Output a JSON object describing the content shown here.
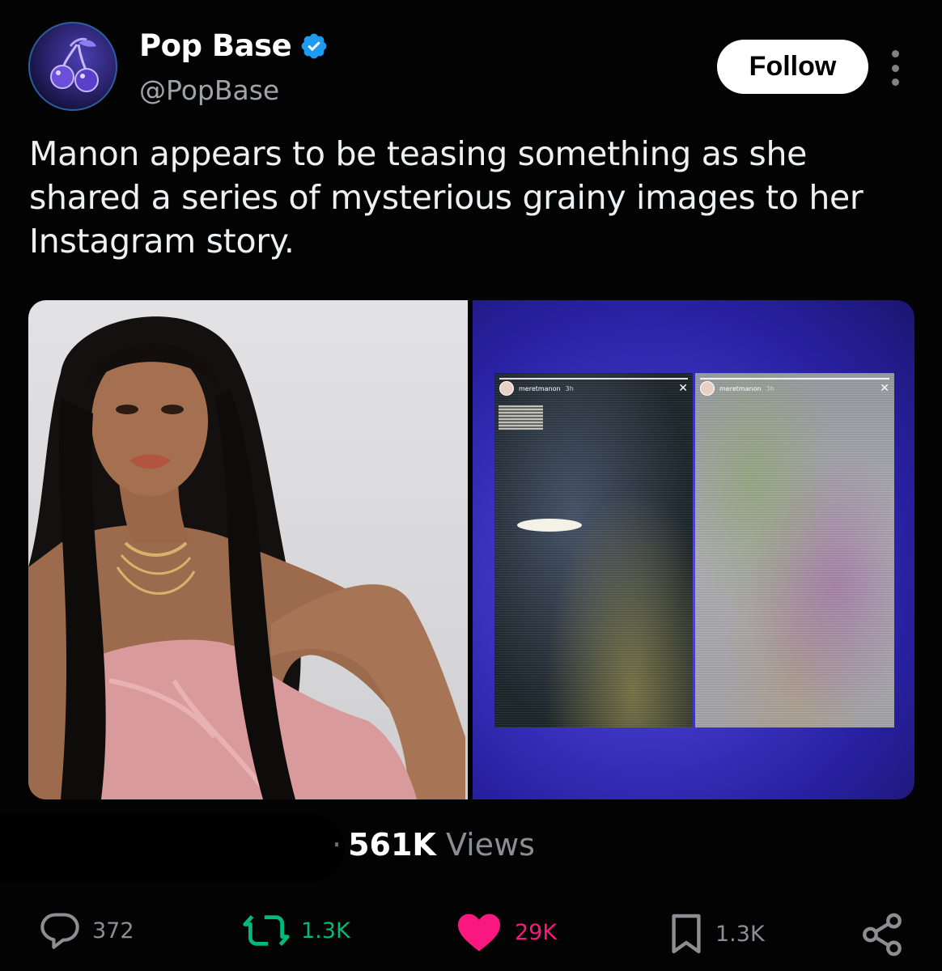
{
  "account": {
    "display_name": "Pop Base",
    "handle": "@PopBase",
    "verified": true,
    "avatar_icon": "cherry-icon"
  },
  "header": {
    "follow_label": "Follow",
    "more_icon": "more-vertical-icon"
  },
  "tweet": {
    "text": "Manon appears to be teasing something as she shared a series of mysterious grainy images to her Instagram story."
  },
  "media": {
    "story_left": {
      "username": "meretmanon",
      "age": "3h"
    },
    "story_right": {
      "username": "meretmanon",
      "age": "3h"
    }
  },
  "stats": {
    "dot": "·",
    "views_count": "561K",
    "views_label": "Views"
  },
  "actions": {
    "reply_count": "372",
    "retweet_count": "1.3K",
    "like_count": "29K",
    "bookmark_count": "1.3K"
  },
  "colors": {
    "background": "#030303",
    "verified": "#1d9bf0",
    "retweet": "#00ba7c",
    "like": "#f91880",
    "muted": "#8b8f93"
  }
}
